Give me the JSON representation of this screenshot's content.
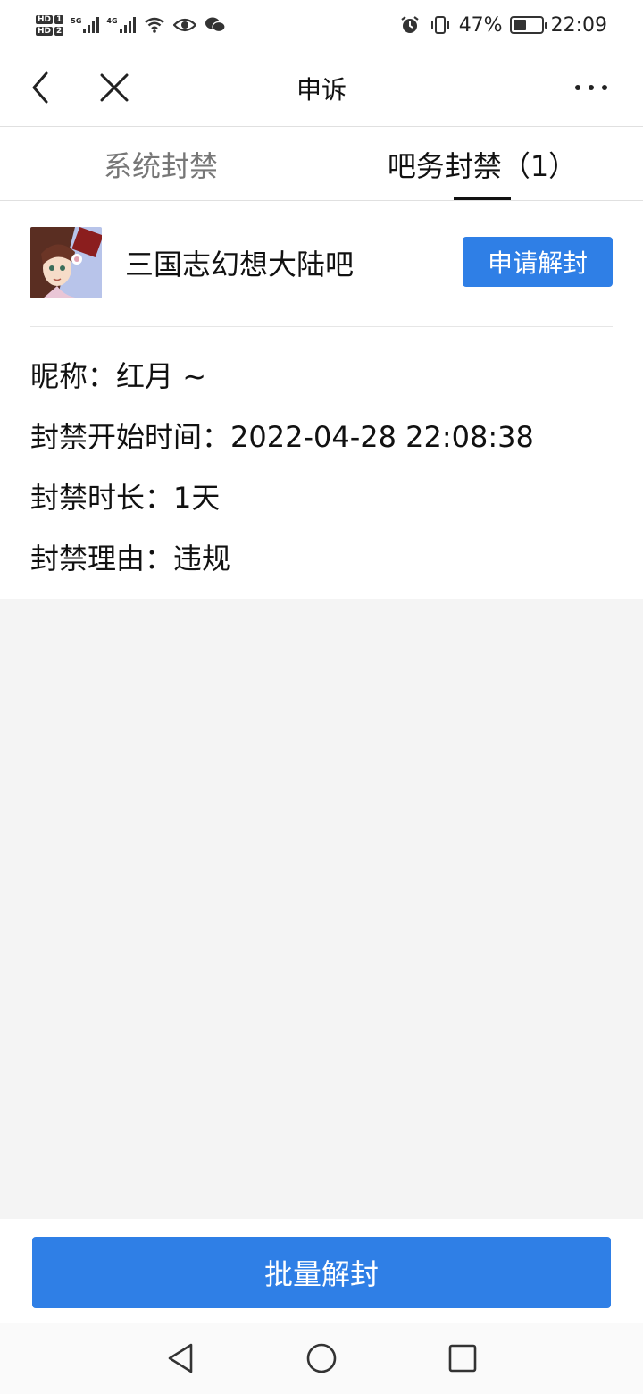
{
  "status_bar": {
    "hd1": "HD",
    "hd1_num": "1",
    "hd2": "HD",
    "hd2_num": "2",
    "sig1_label": "5G",
    "sig2_label": "4G",
    "battery_percent": "47%",
    "battery_level": 0.47,
    "time": "22:09"
  },
  "navbar": {
    "title": "申诉",
    "back_icon": "chevron-left-icon",
    "close_icon": "close-icon",
    "more_icon": "more-icon"
  },
  "tabs": [
    {
      "label": "系统封禁",
      "active": false
    },
    {
      "label": "吧务封禁（1）",
      "active": true
    }
  ],
  "ban_record": {
    "forum_name": "三国志幻想大陆吧",
    "apply_button": "申请解封",
    "nickname_label": "昵称：",
    "nickname_value": "红月 ~",
    "start_label": "封禁开始时间：",
    "start_value": "2022-04-28 22:08:38",
    "duration_label": "封禁时长：",
    "duration_value": "1天",
    "reason_label": "封禁理由：",
    "reason_value": "违规"
  },
  "bottom": {
    "batch_button": "批量解封"
  },
  "colors": {
    "accent": "#2f7fe6",
    "gray_bg": "#f4f4f4"
  }
}
